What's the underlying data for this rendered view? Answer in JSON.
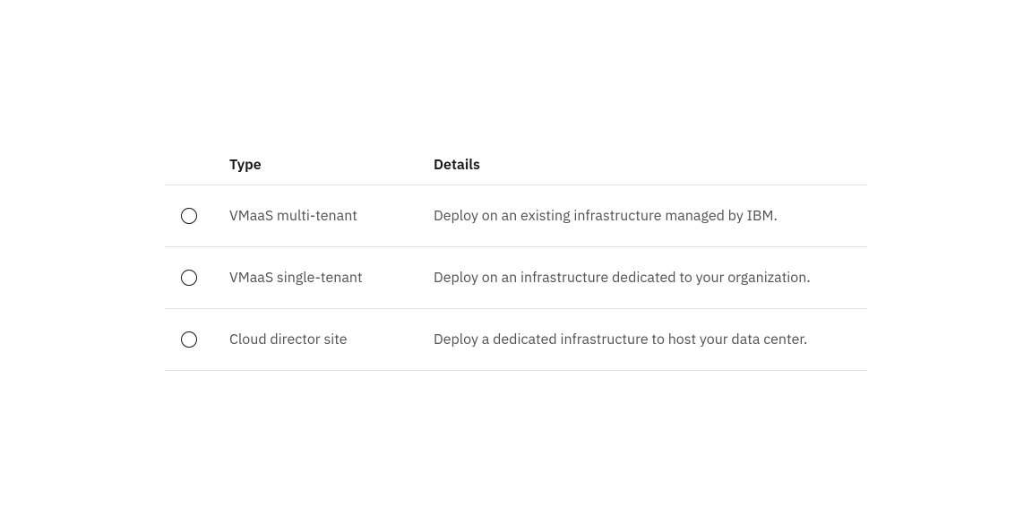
{
  "table": {
    "headers": {
      "type": "Type",
      "details": "Details"
    },
    "rows": [
      {
        "type": "VMaaS multi-tenant",
        "details": "Deploy on an existing infrastructure managed by IBM."
      },
      {
        "type": "VMaaS single-tenant",
        "details": "Deploy on an infrastructure dedicated to your organization."
      },
      {
        "type": "Cloud director site",
        "details": "Deploy a dedicated infrastructure to host your data center."
      }
    ]
  }
}
